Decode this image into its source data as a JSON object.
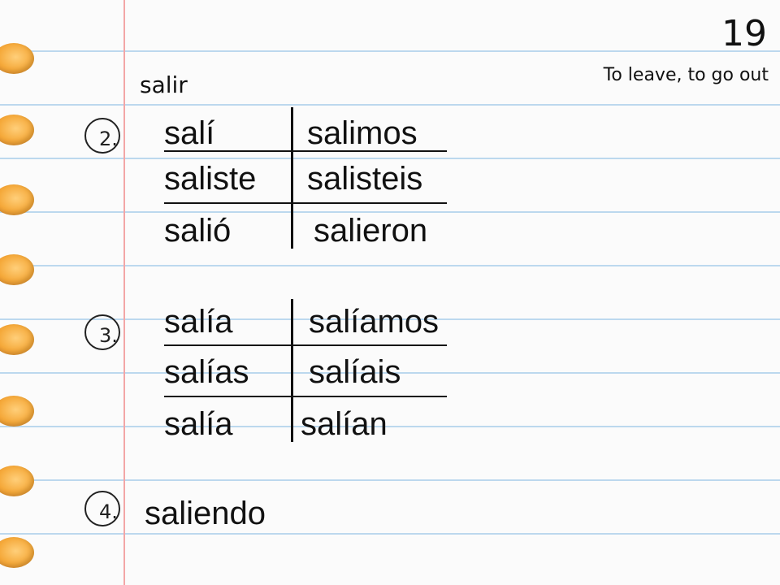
{
  "page_number": "19",
  "verb": {
    "infinitive": "salir",
    "meaning": "To leave, to go out"
  },
  "sections": [
    {
      "number": "2.",
      "forms": [
        "salí",
        "salimos",
        "saliste",
        "salisteis",
        "salió",
        "salieron"
      ]
    },
    {
      "number": "3.",
      "forms": [
        "salía",
        "salíamos",
        "salías",
        "salíais",
        "salía",
        "salían"
      ]
    },
    {
      "number": "4.",
      "form": "saliendo"
    }
  ]
}
